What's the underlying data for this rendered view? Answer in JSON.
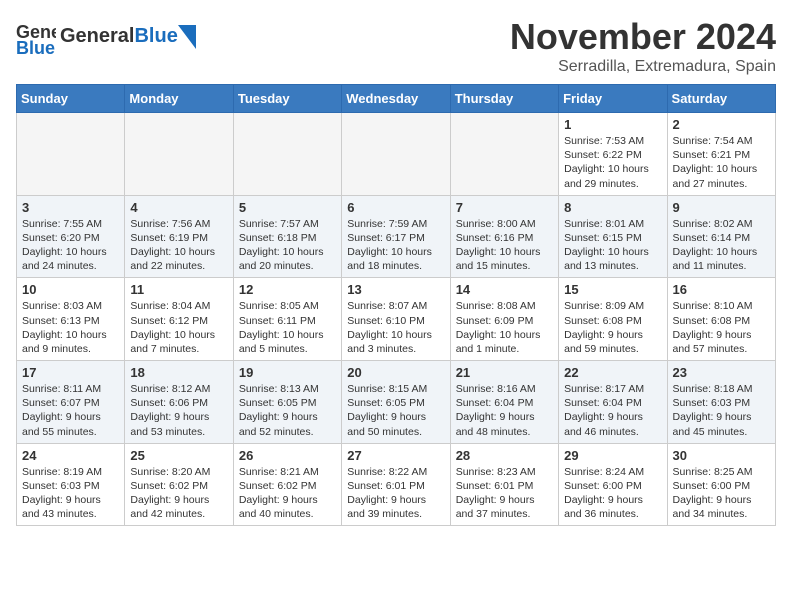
{
  "header": {
    "logo_general": "General",
    "logo_blue": "Blue",
    "month": "November 2024",
    "location": "Serradilla, Extremadura, Spain"
  },
  "days_of_week": [
    "Sunday",
    "Monday",
    "Tuesday",
    "Wednesday",
    "Thursday",
    "Friday",
    "Saturday"
  ],
  "weeks": [
    {
      "days": [
        {
          "num": "",
          "info": "",
          "empty": true
        },
        {
          "num": "",
          "info": "",
          "empty": true
        },
        {
          "num": "",
          "info": "",
          "empty": true
        },
        {
          "num": "",
          "info": "",
          "empty": true
        },
        {
          "num": "",
          "info": "",
          "empty": true
        },
        {
          "num": "1",
          "info": "Sunrise: 7:53 AM\nSunset: 6:22 PM\nDaylight: 10 hours\nand 29 minutes."
        },
        {
          "num": "2",
          "info": "Sunrise: 7:54 AM\nSunset: 6:21 PM\nDaylight: 10 hours\nand 27 minutes."
        }
      ]
    },
    {
      "days": [
        {
          "num": "3",
          "info": "Sunrise: 7:55 AM\nSunset: 6:20 PM\nDaylight: 10 hours\nand 24 minutes."
        },
        {
          "num": "4",
          "info": "Sunrise: 7:56 AM\nSunset: 6:19 PM\nDaylight: 10 hours\nand 22 minutes."
        },
        {
          "num": "5",
          "info": "Sunrise: 7:57 AM\nSunset: 6:18 PM\nDaylight: 10 hours\nand 20 minutes."
        },
        {
          "num": "6",
          "info": "Sunrise: 7:59 AM\nSunset: 6:17 PM\nDaylight: 10 hours\nand 18 minutes."
        },
        {
          "num": "7",
          "info": "Sunrise: 8:00 AM\nSunset: 6:16 PM\nDaylight: 10 hours\nand 15 minutes."
        },
        {
          "num": "8",
          "info": "Sunrise: 8:01 AM\nSunset: 6:15 PM\nDaylight: 10 hours\nand 13 minutes."
        },
        {
          "num": "9",
          "info": "Sunrise: 8:02 AM\nSunset: 6:14 PM\nDaylight: 10 hours\nand 11 minutes."
        }
      ]
    },
    {
      "days": [
        {
          "num": "10",
          "info": "Sunrise: 8:03 AM\nSunset: 6:13 PM\nDaylight: 10 hours\nand 9 minutes."
        },
        {
          "num": "11",
          "info": "Sunrise: 8:04 AM\nSunset: 6:12 PM\nDaylight: 10 hours\nand 7 minutes."
        },
        {
          "num": "12",
          "info": "Sunrise: 8:05 AM\nSunset: 6:11 PM\nDaylight: 10 hours\nand 5 minutes."
        },
        {
          "num": "13",
          "info": "Sunrise: 8:07 AM\nSunset: 6:10 PM\nDaylight: 10 hours\nand 3 minutes."
        },
        {
          "num": "14",
          "info": "Sunrise: 8:08 AM\nSunset: 6:09 PM\nDaylight: 10 hours\nand 1 minute."
        },
        {
          "num": "15",
          "info": "Sunrise: 8:09 AM\nSunset: 6:08 PM\nDaylight: 9 hours\nand 59 minutes."
        },
        {
          "num": "16",
          "info": "Sunrise: 8:10 AM\nSunset: 6:08 PM\nDaylight: 9 hours\nand 57 minutes."
        }
      ]
    },
    {
      "days": [
        {
          "num": "17",
          "info": "Sunrise: 8:11 AM\nSunset: 6:07 PM\nDaylight: 9 hours\nand 55 minutes."
        },
        {
          "num": "18",
          "info": "Sunrise: 8:12 AM\nSunset: 6:06 PM\nDaylight: 9 hours\nand 53 minutes."
        },
        {
          "num": "19",
          "info": "Sunrise: 8:13 AM\nSunset: 6:05 PM\nDaylight: 9 hours\nand 52 minutes."
        },
        {
          "num": "20",
          "info": "Sunrise: 8:15 AM\nSunset: 6:05 PM\nDaylight: 9 hours\nand 50 minutes."
        },
        {
          "num": "21",
          "info": "Sunrise: 8:16 AM\nSunset: 6:04 PM\nDaylight: 9 hours\nand 48 minutes."
        },
        {
          "num": "22",
          "info": "Sunrise: 8:17 AM\nSunset: 6:04 PM\nDaylight: 9 hours\nand 46 minutes."
        },
        {
          "num": "23",
          "info": "Sunrise: 8:18 AM\nSunset: 6:03 PM\nDaylight: 9 hours\nand 45 minutes."
        }
      ]
    },
    {
      "days": [
        {
          "num": "24",
          "info": "Sunrise: 8:19 AM\nSunset: 6:03 PM\nDaylight: 9 hours\nand 43 minutes."
        },
        {
          "num": "25",
          "info": "Sunrise: 8:20 AM\nSunset: 6:02 PM\nDaylight: 9 hours\nand 42 minutes."
        },
        {
          "num": "26",
          "info": "Sunrise: 8:21 AM\nSunset: 6:02 PM\nDaylight: 9 hours\nand 40 minutes."
        },
        {
          "num": "27",
          "info": "Sunrise: 8:22 AM\nSunset: 6:01 PM\nDaylight: 9 hours\nand 39 minutes."
        },
        {
          "num": "28",
          "info": "Sunrise: 8:23 AM\nSunset: 6:01 PM\nDaylight: 9 hours\nand 37 minutes."
        },
        {
          "num": "29",
          "info": "Sunrise: 8:24 AM\nSunset: 6:00 PM\nDaylight: 9 hours\nand 36 minutes."
        },
        {
          "num": "30",
          "info": "Sunrise: 8:25 AM\nSunset: 6:00 PM\nDaylight: 9 hours\nand 34 minutes."
        }
      ]
    }
  ]
}
